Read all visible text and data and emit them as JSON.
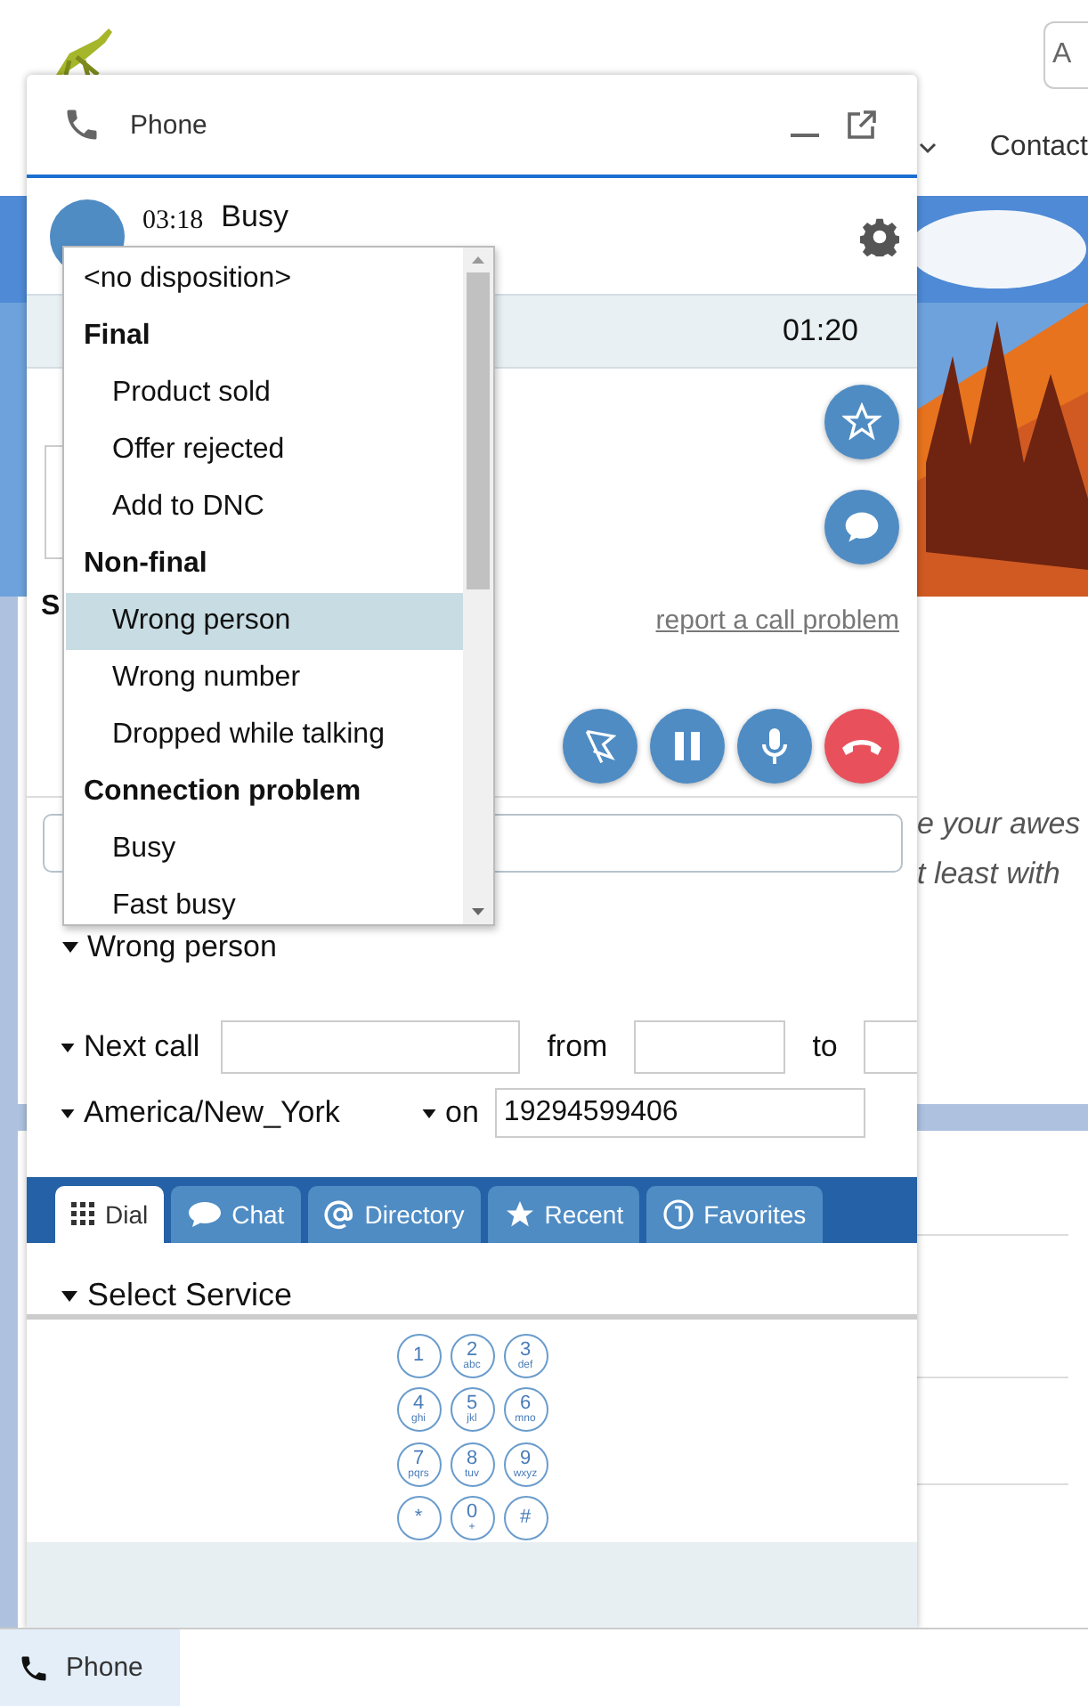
{
  "site": {
    "search_placeholder": "A",
    "nav": [
      {
        "label": "Contact"
      }
    ],
    "card_lines": [
      "e your awes",
      "t least with"
    ]
  },
  "phone": {
    "title": "Phone",
    "call": {
      "timer": "03:18",
      "status": "Busy",
      "duration": "01:20"
    },
    "contact": {
      "section": "S"
    },
    "report_link": "report a call problem",
    "disposition_menu": {
      "items": [
        {
          "label": "<no disposition>",
          "kind": "option",
          "selected": false
        },
        {
          "label": "Final",
          "kind": "group",
          "children": [
            {
              "label": "Product sold",
              "selected": false
            },
            {
              "label": "Offer rejected",
              "selected": false
            },
            {
              "label": "Add to DNC",
              "selected": false
            }
          ]
        },
        {
          "label": "Non-final",
          "kind": "group",
          "children": [
            {
              "label": "Wrong person",
              "selected": true
            },
            {
              "label": "Wrong number",
              "selected": false
            },
            {
              "label": "Dropped while talking",
              "selected": false
            }
          ]
        },
        {
          "label": "Connection problem",
          "kind": "group",
          "children": [
            {
              "label": "Busy",
              "selected": false
            },
            {
              "label": "Fast busy",
              "selected": false
            }
          ]
        }
      ]
    },
    "disposition": "Wrong person",
    "next_call": {
      "label": "Next call",
      "from": "from",
      "to": "to"
    },
    "timezone": "America/New_York",
    "on": "on",
    "phone_number": "19294599406",
    "tabs": [
      {
        "label": "Dial",
        "selected": true
      },
      {
        "label": "Chat",
        "selected": false
      },
      {
        "label": "Directory",
        "selected": false
      },
      {
        "label": "Recent",
        "selected": false
      },
      {
        "label": "Favorites",
        "selected": false
      }
    ],
    "service": "Select Service",
    "keypad": [
      {
        "digit": "1"
      },
      {
        "digit": "2",
        "letters": "abc"
      },
      {
        "digit": "3",
        "letters": "def"
      },
      {
        "digit": "4",
        "letters": "ghi"
      },
      {
        "digit": "5",
        "letters": "jkl"
      },
      {
        "digit": "6",
        "letters": "mno"
      },
      {
        "digit": "7",
        "letters": "pqrs"
      },
      {
        "digit": "8",
        "letters": "tuv"
      },
      {
        "digit": "9",
        "letters": "wxyz"
      },
      {
        "digit": "*"
      },
      {
        "digit": "0",
        "letters": "+"
      },
      {
        "digit": "#"
      }
    ]
  },
  "taskbar": {
    "label": "Phone",
    "selected": true
  }
}
